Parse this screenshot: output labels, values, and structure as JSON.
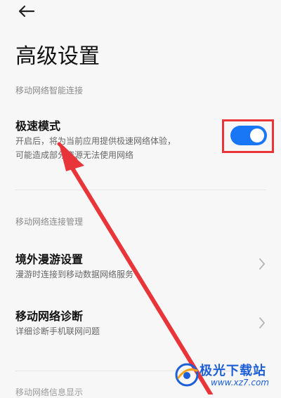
{
  "header": {
    "back_icon": "arrow-left-icon",
    "title": "高级设置"
  },
  "sections": [
    {
      "header": "移动网络智能连接",
      "items": [
        {
          "title": "极速模式",
          "desc_line1": "开启后，将为当前应用提供极速网络体验，",
          "desc_line2": "可能造成部分资源无法使用网络",
          "control": "toggle",
          "toggle_on": true
        }
      ]
    },
    {
      "header": "移动网络连接管理",
      "items": [
        {
          "title": "境外漫游设置",
          "desc": "漫游时连接到移动数据网络服务",
          "control": "chevron-right-icon"
        },
        {
          "title": "移动网络诊断",
          "desc": "详细诊断手机联网问题",
          "control": "chevron-right-icon"
        }
      ]
    }
  ],
  "partial_section_header": "移动网络信息显示",
  "annotation": {
    "highlight_color": "#e8353a",
    "arrow_color": "#e8353a"
  },
  "watermark": {
    "name": "极光下载站",
    "url": "www.xz7.com"
  },
  "colors": {
    "toggle_on": "#1976f5",
    "background": "#f7f7f7"
  }
}
